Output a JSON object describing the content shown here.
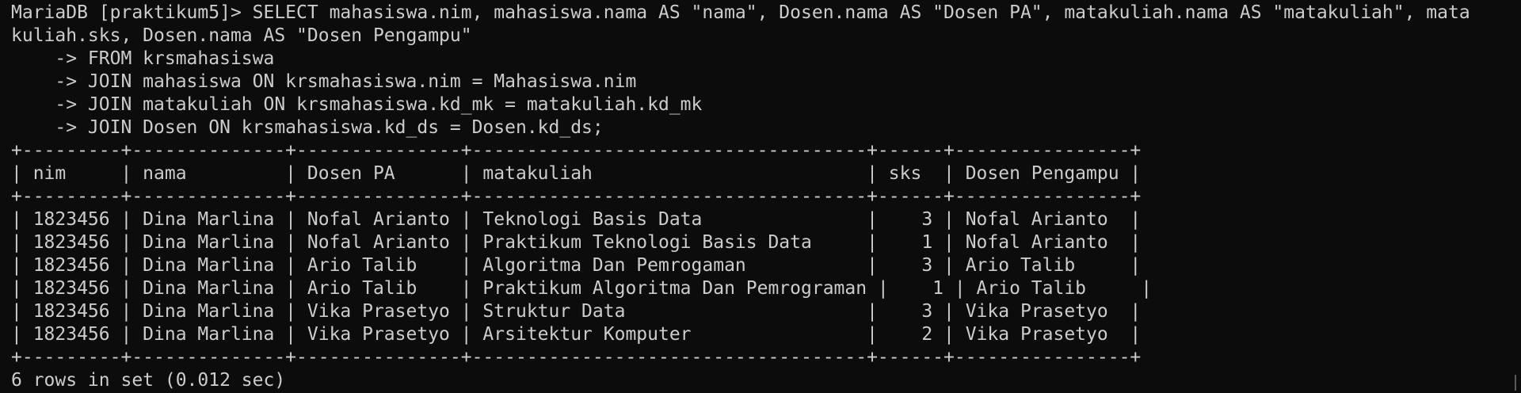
{
  "terminal": {
    "lines": [
      "MariaDB [praktikum5]> SELECT mahasiswa.nim, mahasiswa.nama AS \"nama\", Dosen.nama AS \"Dosen PA\", matakuliah.nama AS \"matakuliah\", mata",
      "kuliah.sks, Dosen.nama AS \"Dosen Pengampu\"",
      "    -> FROM krsmahasiswa",
      "    -> JOIN mahasiswa ON krsmahasiswa.nim = Mahasiswa.nim",
      "    -> JOIN matakuliah ON krsmahasiswa.kd_mk = matakuliah.kd_mk",
      "    -> JOIN Dosen ON krsmahasiswa.kd_ds = Dosen.kd_ds;",
      "+---------+--------------+---------------+------------------------------------+------+----------------+",
      "| nim     | nama         | Dosen PA      | matakuliah                         | sks  | Dosen Pengampu |",
      "+---------+--------------+---------------+------------------------------------+------+----------------+",
      "| 1823456 | Dina Marlina | Nofal Arianto | Teknologi Basis Data               |    3 | Nofal Arianto  |",
      "| 1823456 | Dina Marlina | Nofal Arianto | Praktikum Teknologi Basis Data     |    1 | Nofal Arianto  |",
      "| 1823456 | Dina Marlina | Ario Talib    | Algoritma Dan Pemrogaman           |    3 | Ario Talib     |",
      "| 1823456 | Dina Marlina | Ario Talib    | Praktikum Algoritma Dan Pemrograman |    1 | Ario Talib     |",
      "| 1823456 | Dina Marlina | Vika Prasetyo | Struktur Data                      |    3 | Vika Prasetyo  |",
      "| 1823456 | Dina Marlina | Vika Prasetyo | Arsitektur Komputer                |    2 | Vika Prasetyo  |",
      "+---------+--------------+---------------+------------------------------------+------+----------------+",
      "6 rows in set (0.012 sec)"
    ]
  }
}
